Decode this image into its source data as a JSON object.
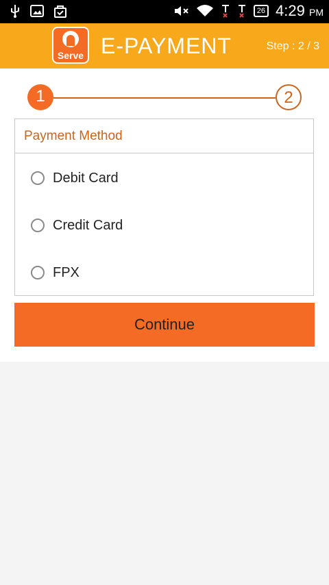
{
  "statusbar": {
    "icons_left": [
      "usb-icon",
      "image-icon",
      "shopping-bag-icon"
    ],
    "icons_right": [
      "mute-icon",
      "wifi-icon",
      "signal-icon",
      "signal-icon"
    ],
    "battery": "26",
    "time": "4:29",
    "ampm": "PM"
  },
  "header": {
    "logo_text": "Serve",
    "title": "E-PAYMENT",
    "step": "Step : 2 / 3"
  },
  "stepper": {
    "step1": "1",
    "step2": "2"
  },
  "payment": {
    "heading": "Payment Method",
    "options": [
      "Debit Card",
      "Credit Card",
      "FPX"
    ],
    "selected": null
  },
  "continue_label": "Continue",
  "colors": {
    "header": "#f7a81b",
    "accent": "#f46b25",
    "heading_text": "#c9651e",
    "background": "#f4f4f4"
  }
}
